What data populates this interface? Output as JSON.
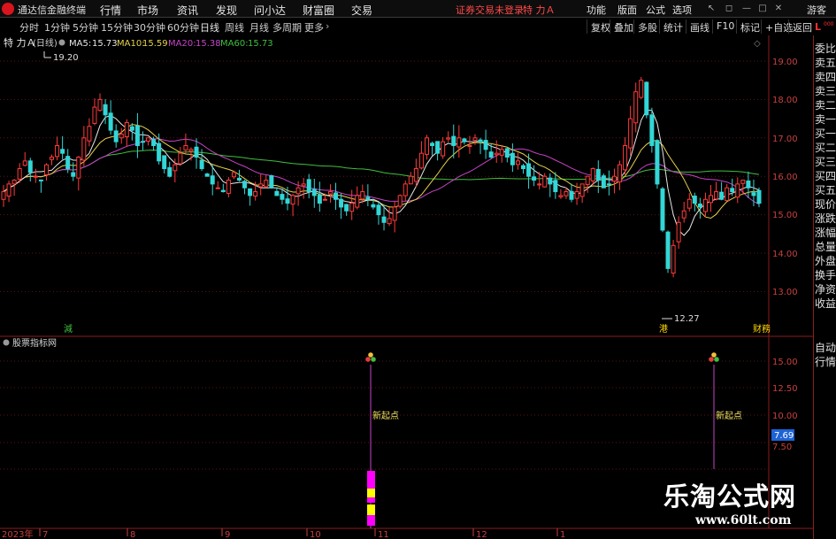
{
  "menubar": {
    "app_title": "通达信金融终端",
    "menus": [
      "行情",
      "市场",
      "资讯",
      "发现",
      "问小达",
      "财富圈",
      "交易"
    ],
    "login_status": "证券交易未登录",
    "stock_title": "特 力Ａ",
    "right_menus": [
      "功能",
      "版面",
      "公式",
      "选项"
    ],
    "guest": "游客"
  },
  "periodbar": {
    "tabs": [
      "分时",
      "1分钟",
      "5分钟",
      "15分钟",
      "30分钟",
      "60分钟",
      "日线",
      "周线",
      "月线",
      "多周期",
      "更多"
    ],
    "active_tab": "日线",
    "tools": [
      "复权",
      "叠加",
      "多股",
      "统计",
      "画线",
      "F10",
      "标记",
      "+自选",
      "返回"
    ]
  },
  "main_chart": {
    "stock_name": "特 力Ａ",
    "period_label": "(日线)",
    "ma": [
      {
        "label": "MA5:",
        "value": "15.73",
        "color": "#e8e8e8"
      },
      {
        "label": "MA10:",
        "value": "15.59",
        "color": "#e6d34a"
      },
      {
        "label": "MA20:",
        "value": "15.38",
        "color": "#c843c8"
      },
      {
        "label": "MA60:",
        "value": "15.73",
        "color": "#3fbf3f"
      }
    ],
    "y_labels": [
      "19.00",
      "18.00",
      "17.00",
      "16.00",
      "15.00",
      "14.00",
      "13.00"
    ],
    "high_label": "19.20",
    "low_label": "12.27",
    "event_tags": [
      {
        "text": "減",
        "color": "#3fbf3f"
      },
      {
        "text": "港",
        "color": "#ffd700"
      },
      {
        "text": "财務",
        "color": "#ffd700"
      }
    ]
  },
  "sub_chart": {
    "title": "股票指标网",
    "y_labels": [
      "15.00",
      "12.50",
      "10.00",
      "7.69",
      "7.50"
    ],
    "current_value": "7.69",
    "signal_label": "新起点"
  },
  "x_axis": {
    "labels": [
      "2023年",
      "7",
      "8",
      "9",
      "10",
      "11",
      "12",
      "1"
    ]
  },
  "right_panel": {
    "header": "L",
    "header_sub": "000",
    "items": [
      "委比",
      "卖五",
      "卖四",
      "卖三",
      "卖二",
      "卖一",
      "买一",
      "买二",
      "买三",
      "买四",
      "买五",
      "现价",
      "涨跌",
      "涨幅",
      "总量",
      "外盘",
      "换手",
      "净资",
      "收益"
    ],
    "bottom_items": [
      "自动",
      "行情"
    ]
  },
  "watermark": {
    "title": "乐淘公式网",
    "url": "www.60lt.com"
  },
  "chart_data": {
    "type": "candlestick",
    "y_range": [
      12.0,
      19.6
    ],
    "close_series": [
      15.6,
      15.8,
      15.9,
      16.2,
      16.4,
      16.1,
      16.0,
      15.9,
      16.3,
      16.5,
      16.8,
      16.6,
      16.2,
      16.0,
      16.5,
      17.0,
      17.3,
      17.8,
      18.0,
      17.6,
      17.2,
      16.9,
      17.1,
      17.4,
      17.2,
      16.8,
      16.9,
      17.0,
      16.8,
      16.4,
      16.2,
      16.0,
      16.3,
      16.6,
      16.8,
      16.7,
      16.5,
      16.2,
      16.0,
      15.8,
      15.7,
      15.6,
      15.9,
      16.1,
      15.9,
      15.7,
      15.5,
      15.6,
      15.8,
      15.9,
      15.7,
      15.5,
      15.4,
      15.3,
      15.5,
      15.7,
      15.8,
      15.6,
      15.5,
      15.3,
      15.4,
      15.6,
      15.4,
      15.2,
      15.1,
      15.3,
      15.5,
      15.6,
      15.4,
      15.2,
      15.0,
      14.8,
      14.9,
      15.2,
      15.5,
      15.8,
      16.0,
      16.2,
      16.6,
      17.0,
      16.8,
      16.6,
      16.9,
      17.0,
      16.8,
      17.0,
      16.9,
      16.8,
      17.0,
      16.9,
      16.7,
      16.5,
      16.6,
      16.7,
      16.5,
      16.3,
      16.4,
      16.2,
      16.0,
      15.9,
      15.8,
      16.0,
      15.8,
      15.6,
      15.5,
      15.6,
      15.4,
      15.6,
      15.8,
      16.0,
      16.2,
      15.9,
      15.7,
      15.8,
      16.0,
      16.3,
      16.8,
      17.5,
      18.2,
      18.5,
      17.6,
      16.8,
      15.8,
      14.6,
      13.6,
      14.2,
      14.8,
      15.1,
      15.4,
      15.3,
      15.2,
      15.4,
      15.5,
      15.6,
      15.4,
      15.7,
      15.6,
      15.8,
      15.9,
      15.7,
      15.5,
      15.3
    ]
  }
}
